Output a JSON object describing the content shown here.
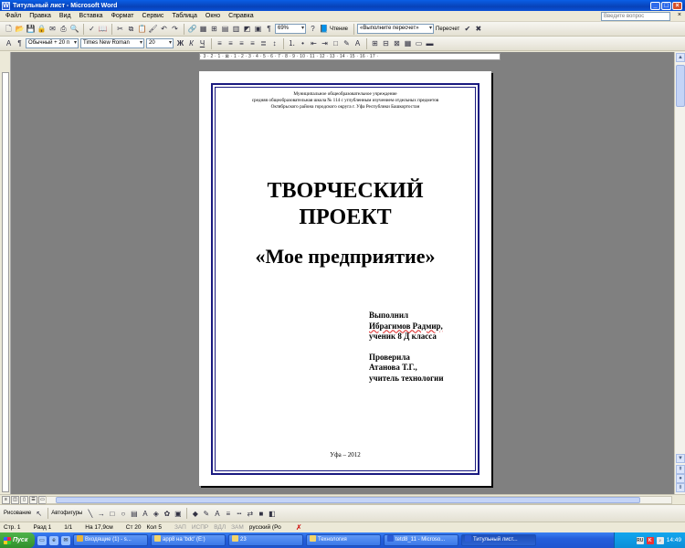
{
  "window": {
    "title": "Титульный лист - Microsoft Word"
  },
  "menu": {
    "items": [
      "Файл",
      "Правка",
      "Вид",
      "Вставка",
      "Формат",
      "Сервис",
      "Таблица",
      "Окно",
      "Справка"
    ],
    "ask_placeholder": "Введите вопрос"
  },
  "standard_toolbar": {
    "zoom": "69%",
    "reading_label": "Чтение",
    "track_changes_combo": "«Выполните пересчет»",
    "recalc_label": "Пересчет"
  },
  "format_toolbar": {
    "style": "Обычный + 20 п",
    "font": "Times New Roman",
    "size": "20",
    "bold": "Ж",
    "italic": "К",
    "underline": "Ч"
  },
  "ruler": {
    "text": "· 3 · 2 · 1 · ⊠ · 1 · 2 · 3 · 4 · 5 · 6 · 7 · 8 · 9 · 10 · 11 · 12 · 13 · 14 · 15 · 16 · 17 ·"
  },
  "document": {
    "header_lines": [
      "Муниципальное общеобразовательное учреждение",
      "средняя общеобразовательная школа № 114 с углубленным изучением отдельных предметов",
      "Октябрьского района городского округа г. Уфа Республики Башкортостан"
    ],
    "title_line1": "ТВОРЧЕСКИЙ",
    "title_line2": "ПРОЕКТ",
    "subtitle": "«Мое предприятие»",
    "performed_label": "Выполнил",
    "performer_name": "Ибрагимов Радмир,",
    "performer_role": "ученик 8 Д класса",
    "checked_label": "Проверила",
    "checker_name": "Атанова Т.Г.,",
    "checker_role": "учитель технологии",
    "city_year": "Уфа – 2012"
  },
  "drawing_toolbar": {
    "draw_label": "Рисование",
    "autoshapes_label": "Автофигуры"
  },
  "status": {
    "page": "Стр. 1",
    "section": "Разд 1",
    "pages": "1/1",
    "position": "На 17,9см",
    "line": "Ст 20",
    "column": "Кол 5",
    "modes": [
      "ЗАП",
      "ИСПР",
      "ВДЛ",
      "ЗАМ"
    ],
    "language": "русский (Ро"
  },
  "taskbar": {
    "start_label": "Пуск",
    "tasks": [
      {
        "label": "Входящие (1) - s...",
        "color": "#E6B43C"
      },
      {
        "label": "app8 на 'bdc' (E:)",
        "color": "#F2D46A"
      },
      {
        "label": "23",
        "color": "#F2D46A"
      },
      {
        "label": "Технология",
        "color": "#F2D46A"
      },
      {
        "label": "tetd8_11 - Microso...",
        "color": "#2B5CD6"
      },
      {
        "label": "Титульный лист...",
        "color": "#2B5CD6"
      }
    ],
    "tray_lang": "RU",
    "clock": "14:49"
  }
}
